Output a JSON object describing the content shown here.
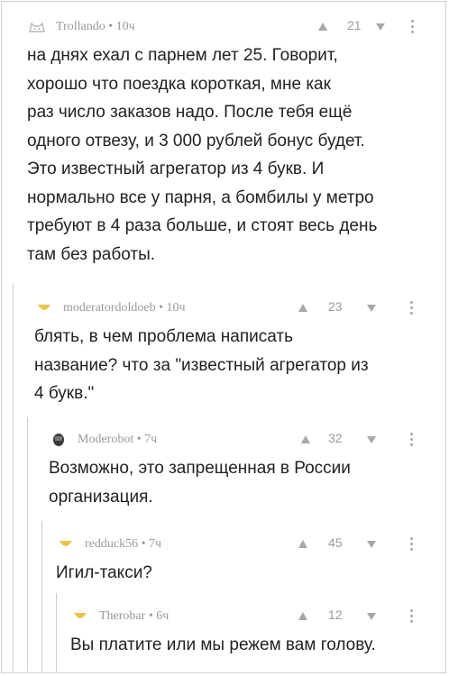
{
  "comments": [
    {
      "author": "Trollando",
      "time": "10ч",
      "score": "21",
      "avatar_icon": "cat-avatar-icon",
      "lines": [
        "на днях ехал с парнем лет 25. Говорит,",
        "хорошо что поездка короткая, мне как",
        "раз число заказов надо. После тебя ещё",
        "одного отвезу, и 3 000 рублей бонус будет.",
        "Это известный агрегатор из 4 букв. И",
        "нормально все у парня, а бомбилы у метро",
        "требуют в 4 раза больше, и стоят весь день",
        "там без работы."
      ]
    },
    {
      "author": "moderatordoldoeb",
      "time": "10ч",
      "score": "23",
      "avatar_icon": "default-avatar-icon",
      "lines": [
        "блять, в чем проблема написать",
        "название? что за \"известный агрегатор из",
        "4 букв.\""
      ]
    },
    {
      "author": "Moderobot",
      "time": "7ч",
      "score": "32",
      "avatar_icon": "robot-avatar-icon",
      "lines": [
        "Возможно, это запрещенная в России",
        "организация."
      ]
    },
    {
      "author": "redduck56",
      "time": "7ч",
      "score": "45",
      "avatar_icon": "default-avatar-icon",
      "lines": [
        "Игил-такси?"
      ]
    },
    {
      "author": "Therobar",
      "time": "6ч",
      "score": "12",
      "avatar_icon": "default-avatar-icon",
      "lines": [
        "Вы платите или мы режем вам голову."
      ]
    }
  ],
  "separator": "•"
}
